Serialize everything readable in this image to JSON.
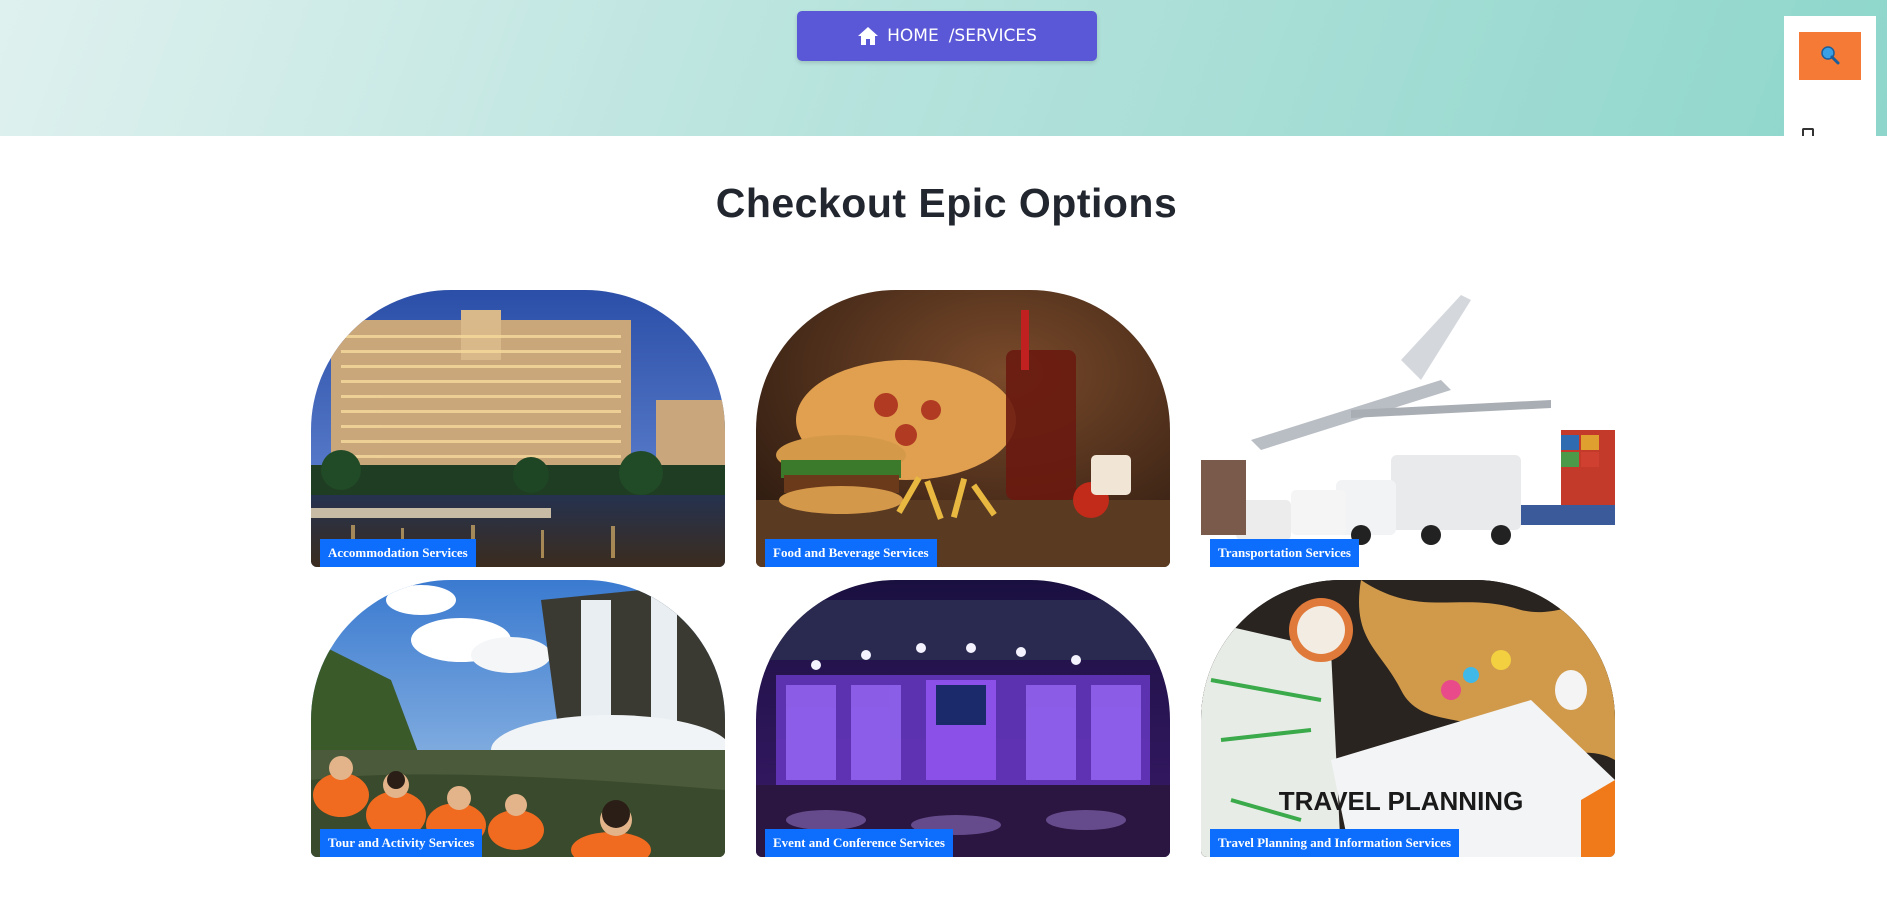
{
  "breadcrumb": {
    "home_label": "HOME",
    "current_label": "/SERVICES"
  },
  "search": {
    "icon": "magnifier-icon",
    "accent": "#f47a36"
  },
  "heading": "Checkout Epic Options",
  "colors": {
    "label_bg": "#0d6efd",
    "breadcrumb_bg": "#5a58d6"
  },
  "services": [
    {
      "label": "Accommodation Services",
      "image": "hotel-photo"
    },
    {
      "label": "Food and Beverage Services",
      "image": "fast-food-photo"
    },
    {
      "label": "Transportation Services",
      "image": "plane-truck-ship-photo"
    },
    {
      "label": "Tour and Activity Services",
      "image": "waterfall-boat-tour-photo"
    },
    {
      "label": "Event and Conference Services",
      "image": "conference-stage-photo"
    },
    {
      "label": "Travel Planning and Information Services",
      "image": "travel-map-photo",
      "image_text": "TRAVEL PLANNING"
    }
  ]
}
